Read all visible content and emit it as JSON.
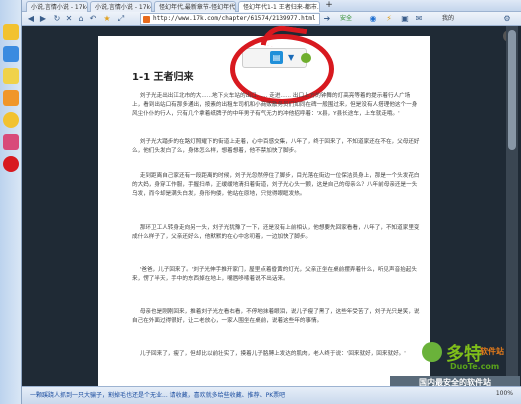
{
  "tabs": [
    {
      "label": "小说,言情小说 - 17k小说网"
    },
    {
      "label": "小说,言情小说 - 17k小说网"
    },
    {
      "label": "怪幻年代,最新章节-怪幻年代txt下"
    },
    {
      "label": "怪幻年代1-1 王者归来-都市..."
    }
  ],
  "toolbar": {
    "address": "http://www.17k.com/chapter/61574/2139977.html",
    "safe_label": "安全",
    "right_labels": [
      "我的"
    ]
  },
  "reader": {
    "chapter_title": "1-1 王者归来",
    "paragraphs": [
      "刘子光走出出江北市的大......地下火车站的出口...... 走进...... 出口上方的钟舞的灯高亮等着的提示着行人广场上，看到出站口有那多通出，按素的出租车司机和小商贩散务员们如同在碑一般围过来，但是没有人搭理他这个一身风尘仆仆的行人，只有几个拿着纸牌子的中年男子有气无力的冲他招呼着：'X县，Y县长途车，上车就走哦。'",
      "刘子光大踏步的在路灯照耀下的街道上走着，心中百感交集，八年了，终于回来了，不知道家还在不在，父母还好么，他们头发白了么，身体怎么样，想着想着，他不禁加快了脚步。",
      "走到距离自己家还有一段距离的时候，刘子光忽然停住了脚步，目光落在街边一位保洁员身上，那是一个头发花白的大妈，身穿工作服，手握扫帚，正缓缓地清扫着街道，刘子光心头一颤，这是自己的母亲么？八年前母亲还是一头乌发，而今却是满头白发，身形佝偻，他站在原地，只觉得眼眶发热。",
      "那环卫工人转身走向另一头，刘子光犹豫了一下，还是没有上前相认，他想要先回家看看，八年了，不知道家里变成什么样子了，父亲还好么，他默默的在心中念叨着，一边加快了脚步。",
      "'爸爸，儿子回来了。'刘子光伸手推开家门，屋里点着昏黄的灯光，父亲正坐在桌前摆弄着什么，听见声音抬起头来，愣了半天，手中的东西掉在地上，嘴唇哆嗦着说不出话来。",
      "母亲也是刚刚回来，推着刘子光左看右看，不停地抹着眼泪，说儿子瘦了黑了，这些年受苦了，刘子光只是笑，说自己在外面过得很好，让二老放心，一家人围坐在桌前，说着这些年的事情。",
      "儿子回来了，瘦了，但却比以前壮实了，摸着儿子胳膊上发达的肌肉，老人终于说：'回来就好，回来就好。'"
    ]
  },
  "status": {
    "text": "一颗蹊跷人抓到一只大骗子，割掉毛也还是个无业... 请收藏，喜欢就多给些收藏、推荐、PK票吧",
    "right": "100%"
  },
  "watermark": {
    "main": "多特",
    "sub": "软件站",
    "url": "DuoTe.com",
    "bottom": "国内最安全的软件站"
  }
}
